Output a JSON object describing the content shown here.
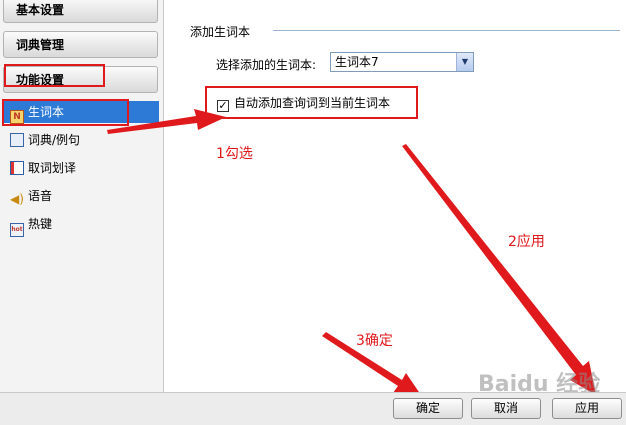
{
  "sidebar": {
    "categories": [
      {
        "label": "基本设置"
      },
      {
        "label": "词典管理"
      },
      {
        "label": "功能设置"
      }
    ],
    "sub_items": [
      {
        "label": "生词本",
        "icon": "notebook-icon",
        "selected": true
      },
      {
        "label": "词典/例句",
        "icon": "dictionary-icon",
        "selected": false
      },
      {
        "label": "取词划译",
        "icon": "word-capture-icon",
        "selected": false
      },
      {
        "label": "语音",
        "icon": "speaker-icon",
        "selected": false
      },
      {
        "label": "热键",
        "icon": "hotkey-icon",
        "selected": false
      }
    ]
  },
  "panel": {
    "group_title": "添加生词本",
    "select_label": "选择添加的生词本:",
    "select_value": "生词本7",
    "checkbox_label": "自动添加查询词到当前生词本",
    "checkbox_checked": true
  },
  "annotations": {
    "step1": "1勾选",
    "step2": "2应用",
    "step3": "3确定"
  },
  "buttons": {
    "ok": "确定",
    "cancel": "取消",
    "apply": "应用"
  },
  "watermark": "Baidu 经验",
  "colors": {
    "annotation_red": "#e0191c",
    "selection_blue": "#2d79d6"
  }
}
